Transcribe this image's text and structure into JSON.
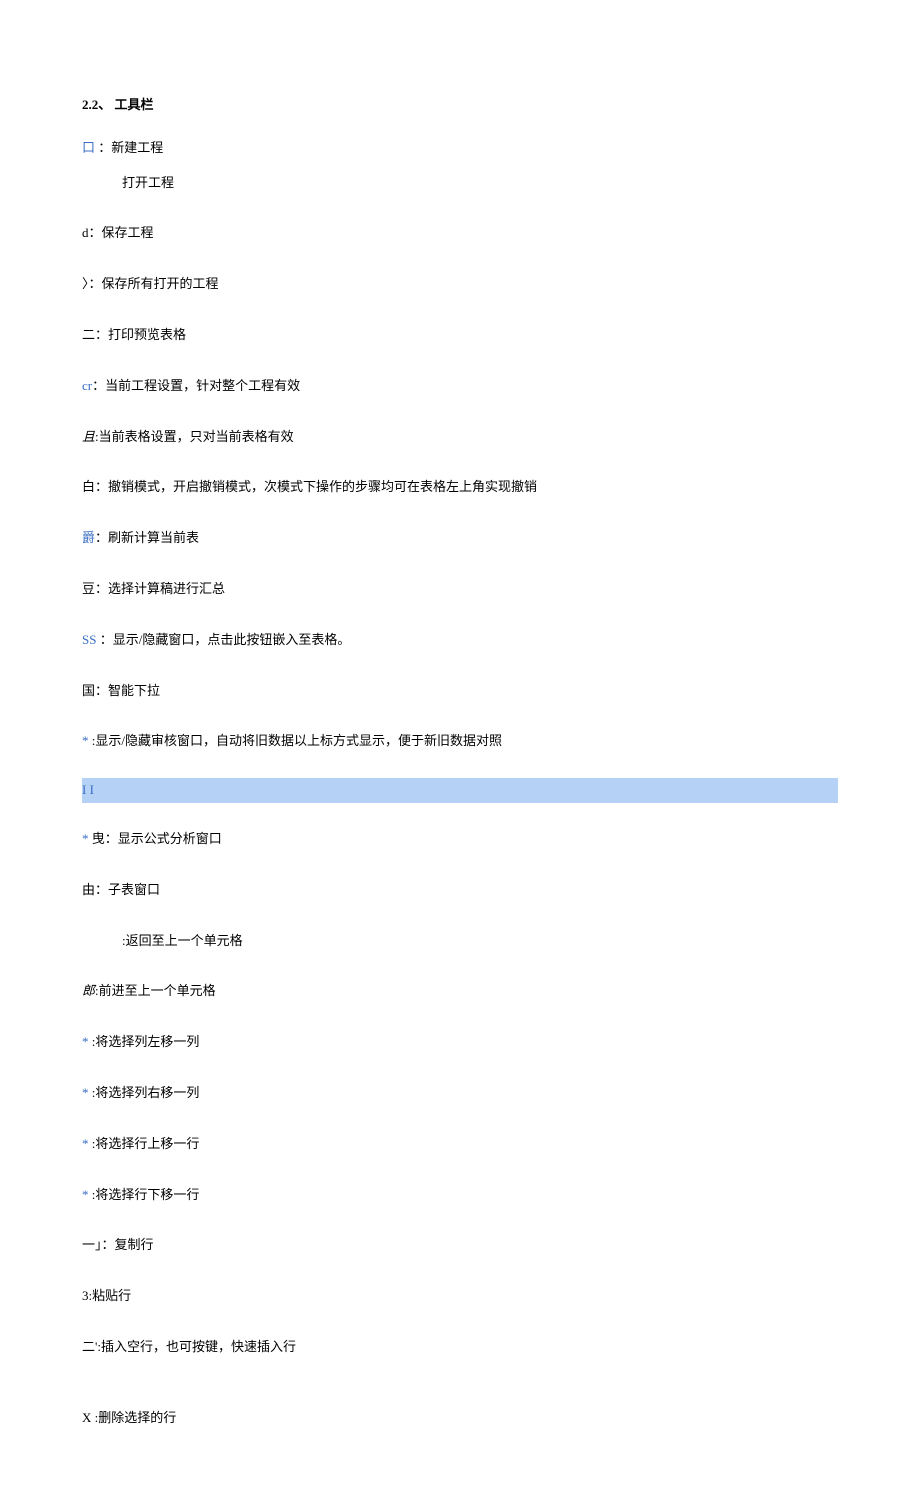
{
  "title": "2.2、 工具栏",
  "items": [
    {
      "key": "口",
      "keyClass": "blue",
      "sep": " ：",
      "text": "新建工程",
      "extra": "first"
    },
    {
      "key": "",
      "keyClass": "",
      "sep": "",
      "text": "打开工程",
      "extra": "indent"
    },
    {
      "key": "d",
      "keyClass": "",
      "sep": "：",
      "text": "保存工程"
    },
    {
      "key": "〉",
      "keyClass": "",
      "sep": "：",
      "text": "保存所有打开的工程"
    },
    {
      "key": "二",
      "keyClass": "",
      "sep": "：",
      "text": "打印预览表格"
    },
    {
      "key": "cr",
      "keyClass": "blue",
      "sep": "：",
      "text": "当前工程设置，针对整个工程有效"
    },
    {
      "key": "且",
      "keyClass": "italic",
      "sep": ":",
      "text": "当前表格设置，只对当前表格有效"
    },
    {
      "key": "白",
      "keyClass": "",
      "sep": "：",
      "text": "撤销模式，开启撤销模式，次模式下操作的步骤均可在表格左上角实现撤销"
    },
    {
      "key": "爵",
      "keyClass": "blue",
      "sep": "：",
      "text": "刷新计算当前表"
    },
    {
      "key": "豆",
      "keyClass": "",
      "sep": "：",
      "text": "选择计算稿进行汇总"
    },
    {
      "key": "SS",
      "keyClass": "blue",
      "sep": " ：",
      "text": "显示/隐藏窗口，点击此按钮嵌入至表格。"
    },
    {
      "key": "国",
      "keyClass": "",
      "sep": "：",
      "text": "智能下拉"
    },
    {
      "key": "*",
      "keyClass": "blue",
      "sep": "   :",
      "text": "显示/隐藏审核窗口，自动将旧数据以上标方式显示，便于新旧数据对照"
    }
  ],
  "highlight": "I I",
  "items2": [
    {
      "key": "*",
      "keyClass": "blue",
      "sep": "   曳：",
      "text": "显示公式分析窗口"
    },
    {
      "key": "由",
      "keyClass": "",
      "sep": "：",
      "text": "子表窗口"
    },
    {
      "key": "",
      "keyClass": "",
      "sep": "",
      "text": ":返回至上一个单元格",
      "extra": "indent"
    },
    {
      "key": "郎",
      "keyClass": "italic",
      "sep": ":",
      "text": "前进至上一个单元格"
    },
    {
      "key": "*",
      "keyClass": "blue",
      "sep": "   :",
      "text": "将选择列左移一列"
    },
    {
      "key": "*",
      "keyClass": "blue",
      "sep": "   :",
      "text": "将选择列右移一列"
    },
    {
      "key": "*",
      "keyClass": "blue",
      "sep": "   :",
      "text": "将选择行上移一行"
    },
    {
      "key": "*",
      "keyClass": "blue",
      "sep": "   :",
      "text": "将选择行下移一行"
    },
    {
      "key": "一」",
      "keyClass": "",
      "sep": "：",
      "text": "复制行"
    },
    {
      "key": "3",
      "keyClass": "",
      "sep": ":",
      "text": "粘贴行"
    },
    {
      "key": "二'",
      "keyClass": "",
      "sep": ":",
      "text": "插入空行，也可按键，快速插入行",
      "extra": "gap-large"
    },
    {
      "key": "X",
      "keyClass": "",
      "sep": " :",
      "text": "删除选择的行"
    }
  ]
}
